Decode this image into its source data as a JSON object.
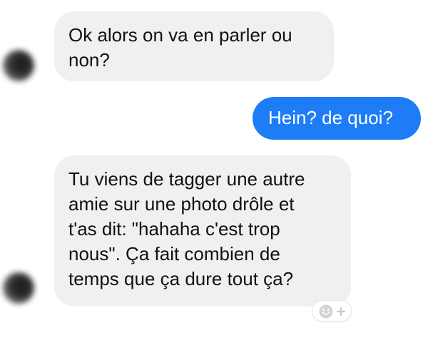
{
  "conversation": {
    "messages": [
      {
        "direction": "incoming",
        "text": "Ok alors on va en parler ou\nnon?"
      },
      {
        "direction": "outgoing",
        "text": "Hein? de quoi?"
      },
      {
        "direction": "incoming",
        "text": "Tu viens de tagger une autre\namie sur une photo drôle et\nt'as dit: \"hahaha c'est trop\nnous\". Ça fait combien de\ntemps que ça dure tout ça?"
      }
    ]
  },
  "icons": {
    "avatar": "avatar-blurred",
    "reaction": "smiley-plus-icon"
  },
  "colors": {
    "incoming_bubble": "#f1f0f0",
    "outgoing_bubble": "#1e7cf7",
    "incoming_text": "#111111",
    "outgoing_text": "#ffffff"
  }
}
